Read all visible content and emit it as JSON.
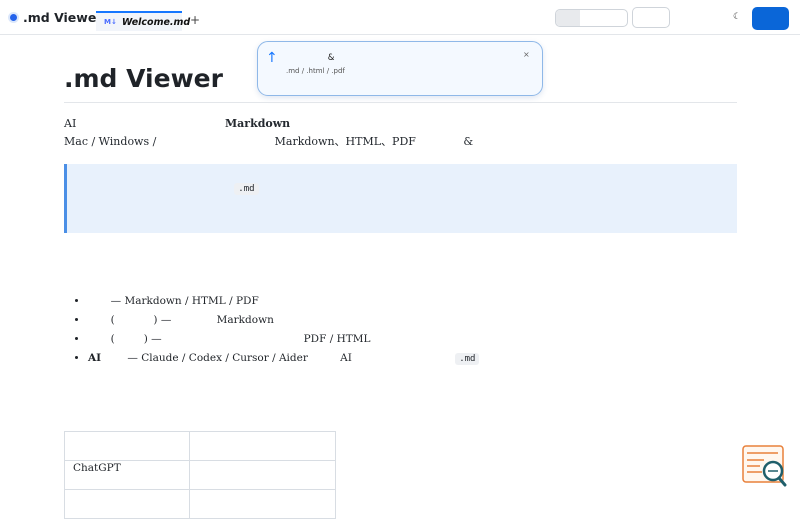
{
  "app": {
    "title": ".md Viewer"
  },
  "tabs": [
    {
      "icon": "M↓",
      "label": "Welcome.md",
      "active": true
    }
  ],
  "tab_add": "+",
  "toolbar": {
    "segments": [
      "ᅟᅟ",
      "ᅟᅟᅟ",
      "ᅟᅟ"
    ],
    "open_button": "ᅟ ᅟᅟ",
    "item1": "ᅟᅟ",
    "item2": "ᅟᅟ",
    "theme_icon": "☾",
    "primary_button": "ᅟᅟᅟ"
  },
  "toast": {
    "title": "ᅟ ᅟᅟᅟᅟ&ᅟᅟᅟᅟᅟᅟᅟᅟᅟᅟᅟᅟ",
    "body_1": ".md / .html / .pdf ᅟ ᅟᅟᅟᅟᅟᅟᅟᅟᅟ ᅟᅟᅟᅟᅟᅟᅟᅟᅟᅟᅟᅟᅟ ᅟᅟᅟᅟᅟᅟᅟᅟᅟᅟᅟᅟᅟᅟᅟᅟ",
    "body_2": "ᅟᅟ ᅟᅟᅟᅟᅟᅟᅟᅟᅟᅟᅟᅟ",
    "close": "×"
  },
  "doc": {
    "h1": ".md Viewer",
    "intro_1a": "AI ᅟᅟᅟᅟᅟᅟᅟᅟᅟᅟᅟᅟᅟᅟ ",
    "intro_1b": "Markdown",
    "intro_1c": " ᅟᅟᅟᅟᅟᅟᅟᅟᅟᅟᅟᅟᅟᅟᅟ",
    "intro_2": "Mac / Windows / ᅟᅟᅟᅟᅟᅟᅟᅟᅟᅟᅟ Markdown、HTML、PDF ᅟᅟᅟᅟ & ᅟᅟᅟᅟᅟ",
    "callout_1a": "ᅟᅟᅟᅟᅟᅟᅟᅟᅟᅟᅟᅟᅟᅟᅟ ",
    "callout_code": ".md",
    "callout_1b": " ᅟᅟᅟᅟᅟᅟᅟᅟᅟᅟᅟᅟᅟᅟᅟᅟᅟᅟᅟᅟᅟ",
    "callout_2": "ᅟᅟᅟᅟᅟᅟᅟᅟᅟᅟᅟᅟᅟ ᅟᅟᅟᅟᅟ ᅟᅟᅟ ᅟᅟᅟᅟᅟᅟᅟᅟᅟᅟᅟᅟᅟᅟᅟᅟᅟᅟᅟ",
    "h2_features": "ᅟᅟᅟᅟᅟ",
    "features": [
      {
        "lead": "",
        "text": "ᅟᅟ — Markdown / HTML / PDF ᅟᅟᅟᅟᅟᅟᅟᅟᅟᅟᅟᅟᅟᅟᅟᅟᅟᅟᅟᅟᅟᅟᅟᅟᅟᅟᅟᅟᅟᅟ"
      },
      {
        "lead": "",
        "text": "ᅟᅟ (ᅟᅟᅟᅟ) — ᅟᅟᅟᅟ Markdown ᅟᅟᅟᅟ ᅟᅟᅟᅟᅟᅟᅟᅟᅟᅟᅟᅟᅟ"
      },
      {
        "lead": "",
        "text": "ᅟᅟ (ᅟᅟᅟ) — ᅟᅟᅟᅟᅟᅟᅟᅟᅟᅟᅟᅟᅟᅟ PDF / HTML ᅟᅟᅟᅟᅟᅟᅟᅟᅟᅟᅟᅟᅟᅟᅟᅟᅟᅟᅟ"
      },
      {
        "lead": "AI ᅟᅟ",
        "text": " — Claude / Codex / Cursor / Aider ᅟᅟᅟAI ᅟᅟᅟᅟᅟᅟᅟᅟᅟᅟ ",
        "code": ".md",
        "tail": " ᅟᅟᅟᅟᅟᅟᅟᅟᅟᅟᅟᅟᅟᅟᅟᅟᅟ"
      }
    ],
    "h2_compare": "ᅟᅟᅟᅟᅟᅟ",
    "table": {
      "headers": [
        "ᅟᅟ",
        "ᅟᅟᅟᅟᅟ"
      ],
      "rows": [
        [
          "ChatGPT ᅟᅟᅟᅟᅟᅟᅟᅟᅟ",
          "ᅟᅟᅟᅟᅟᅟᅟᅟᅟᅟ"
        ]
      ]
    }
  },
  "colors": {
    "accent": "#0a66d8",
    "callout_bg": "#e8f1fc",
    "callout_border": "#4b8fe6",
    "widget_orange": "#e8803a",
    "widget_teal": "#1f5f6b"
  },
  "icons": {
    "brand": "dot-icon",
    "toast": "arrow-up-icon",
    "widget": "search-doc-icon"
  }
}
